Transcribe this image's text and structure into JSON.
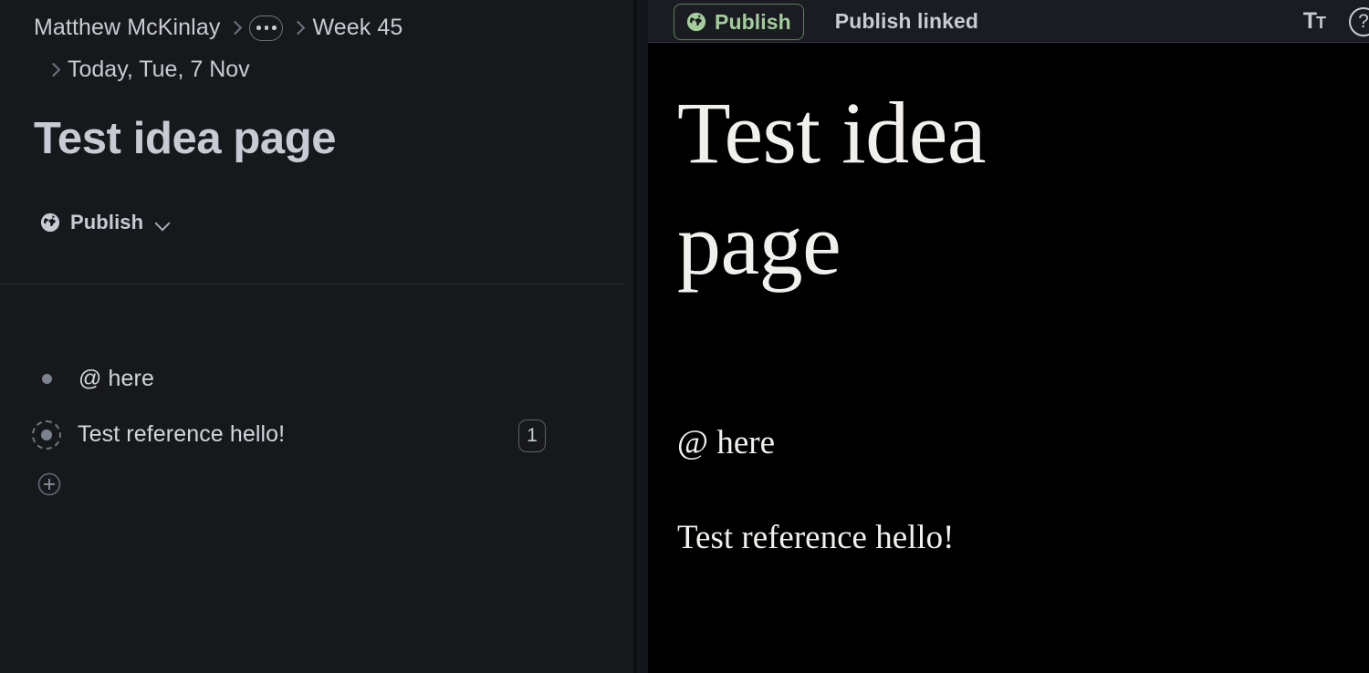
{
  "editor": {
    "breadcrumb": {
      "user": "Matthew McKinlay",
      "ellipsis_label": "…",
      "week": "Week 45",
      "day": "Today, Tue, 7 Nov"
    },
    "page_title": "Test idea page",
    "publish": {
      "label": "Publish",
      "icon": "globe-icon",
      "caret_icon": "chevron-down-icon"
    },
    "blocks": [
      {
        "text": "@ here",
        "bullet": "plain-bullet",
        "ref_count": ""
      },
      {
        "text": "Test reference hello!",
        "bullet": "reference-bullet",
        "ref_count": "1"
      }
    ],
    "add_block_icon": "plus-circle-icon"
  },
  "preview": {
    "toolbar": {
      "publish_button": "Publish",
      "publish_button_icon": "globe-icon",
      "publish_linked": "Publish linked",
      "typography_icon_main": "T",
      "typography_icon_sub": "T",
      "help_icon": "?"
    },
    "title": "Test idea page",
    "paragraphs": [
      "@ here",
      "Test reference hello!"
    ]
  },
  "colors": {
    "editor_bg": "#17181c",
    "preview_bg": "#000000",
    "toolbar_bg": "#1a1c21",
    "publish_green": "#a3ce9c",
    "publish_green_border": "#5d7f57",
    "text_primary": "#c9cbd4",
    "preview_text": "#f2f0ec",
    "muted": "#6f7480"
  }
}
